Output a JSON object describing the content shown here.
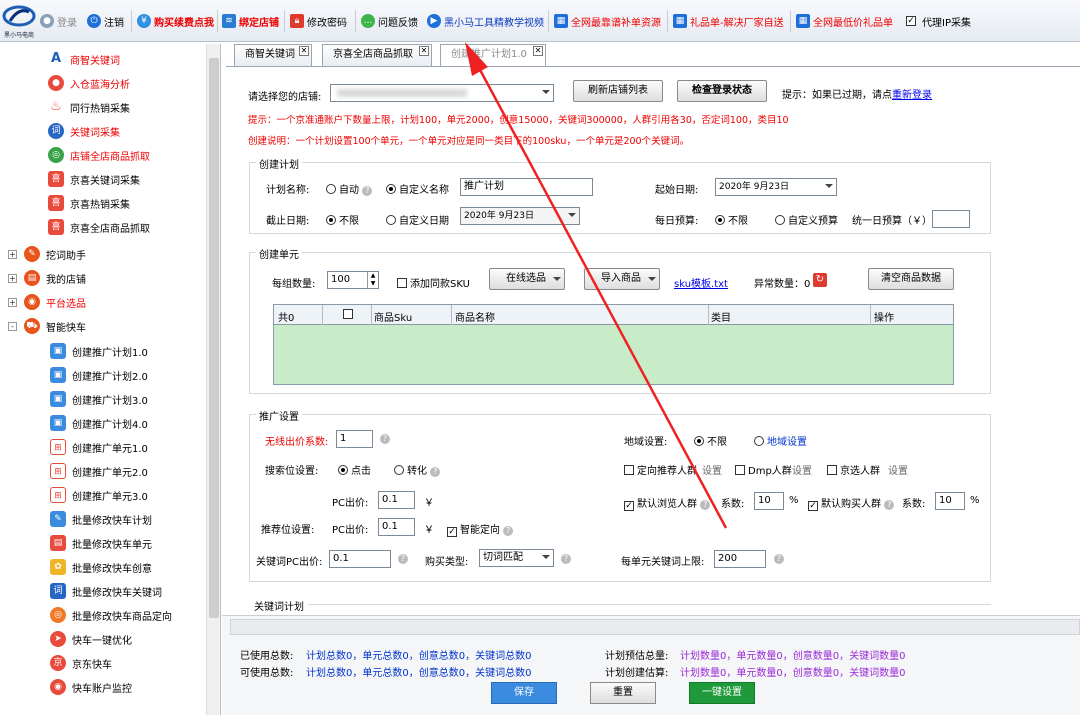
{
  "toolbar": {
    "logo_text": "黑小马电商",
    "items": [
      "登录",
      "注销",
      "购买续费点我",
      "绑定店铺",
      "修改密码",
      "问题反馈",
      "黑小马工具精教学视频",
      "全网最靠谱补单资源",
      "礼品单-解决厂家自送",
      "全网最低价礼品单",
      "代理IP采集"
    ],
    "accent_red": "#e60000",
    "accent_blue": "#0b3bbf"
  },
  "sidebar": {
    "items": [
      "商智关键词",
      "入仓蓝海分析",
      "同行热销采集",
      "关键词采集",
      "店铺全店商品抓取",
      "京喜关键词采集",
      "京喜热销采集",
      "京喜全店商品抓取",
      "挖词助手",
      "我的店铺",
      "平台选品",
      "智能快车",
      "创建推广计划1.0",
      "创建推广计划2.0",
      "创建推广计划3.0",
      "创建推广计划4.0",
      "创建推广单元1.0",
      "创建推广单元2.0",
      "创建推广单元3.0",
      "批量修改快车计划",
      "批量修改快车单元",
      "批量修改快车创意",
      "批量修改快车关键词",
      "批量修改快车商品定向",
      "快车一键优化",
      "京东快车",
      "快车账户监控"
    ],
    "toggles": [
      "+",
      "+",
      "+",
      "-"
    ]
  },
  "tabs": [
    "商智关键词",
    "京喜全店商品抓取",
    "创建推广计划1.0"
  ],
  "store": {
    "label": "请选择您的店铺:",
    "refresh_btn": "刷新店铺列表",
    "check_btn": "检查登录状态",
    "hint": "提示：如果已过期，请点",
    "hint_link": "重新登录"
  },
  "notice": "提示：一个京准通账户下数量上限，计划100，单元2000，创意15000，关键词300000，人群引用各30，否定词100，类目10",
  "explain": "创建说明：一个计划设置100个单元，一个单元对应是同一类目下的100sku，一个单元是200个关键词。",
  "plan": {
    "title": "创建计划",
    "name_label": "计划名称:",
    "auto": "自动",
    "custom_name": "自定义名称",
    "name_value": "推广计划",
    "start_label": "起始日期:",
    "start_value": "2020年 9月23日",
    "end_label": "截止日期:",
    "unlimited": "不限",
    "custom_date": "自定义日期",
    "end_value": "2020年 9月23日",
    "budget_label": "每日预算:",
    "custom_budget": "自定义预算",
    "unified_budget": "统一日预算（￥）"
  },
  "unit": {
    "title": "创建单元",
    "group_count_label": "每组数量:",
    "group_count": "100",
    "add_same_sku": "添加同款SKU",
    "online_select": "在线选品",
    "import": "导入商品",
    "template_link": "sku模板.txt",
    "abnormal": "异常数量：0",
    "clear_btn": "清空商品数据",
    "columns": [
      "共0",
      "",
      "商品Sku",
      "商品名称",
      "类目",
      "操作"
    ]
  },
  "promo": {
    "title": "推广设置",
    "wireless_label": "无线出价系数:",
    "wireless_value": "1",
    "region_label": "地域设置:",
    "region_unlimited": "不限",
    "region_set": "地域设置",
    "search_label": "搜索位设置:",
    "click": "点击",
    "convert": "转化",
    "targeted": "定向推荐人群",
    "set": "设置",
    "dmp": "Dmp人群",
    "jx": "京选人群",
    "pc_label": "PC出价:",
    "pc_value": "0.1",
    "yen": "￥",
    "browse": "默认浏览人群",
    "coef": "系数:",
    "coef_value": "10",
    "pct": "%",
    "buy": "默认购买人群",
    "recommend_label": "推荐位设置:",
    "smart": "智能定向",
    "kw_pc_label": "关键词PC出价:",
    "kw_pc_value": "0.1",
    "buy_type_label": "购买类型:",
    "buy_type_value": "切词匹配",
    "kw_limit_label": "每单元关键词上限:",
    "kw_limit_value": "200",
    "kw_plan_title": "关键词计划"
  },
  "footer": {
    "used_label": "已使用总数:",
    "used_value": "计划总数0，单元总数0，创意总数0，关键词总数0",
    "avail_label": "可使用总数:",
    "avail_value": "计划总数0，单元总数0，创意总数0，关键词总数0",
    "est_label": "计划预估总量:",
    "est_value": "计划数量0，单元数量0，创意数量0，关键词数量0",
    "created_label": "计划创建估算:",
    "created_value": "计划数量0，单元数量0，创意数量0，关键词数量0",
    "save": "保存",
    "reset": "重置",
    "one_click": "一键设置"
  }
}
